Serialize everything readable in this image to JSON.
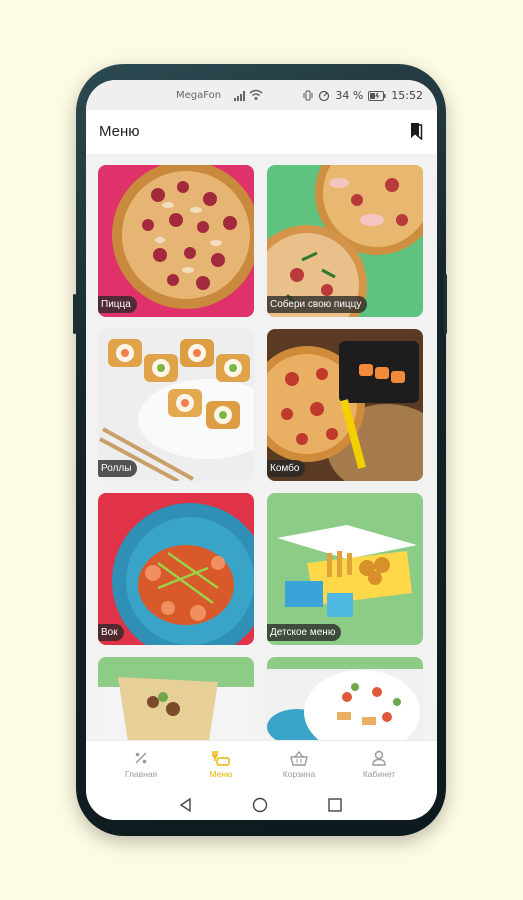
{
  "status_bar": {
    "carrier": "MegaFon",
    "battery": "34 %",
    "time": "15:52"
  },
  "app_bar": {
    "title": "Меню"
  },
  "categories": [
    {
      "label": "Пицца"
    },
    {
      "label": "Собери свою пиццу"
    },
    {
      "label": "Роллы"
    },
    {
      "label": "Комбо"
    },
    {
      "label": "Вок"
    },
    {
      "label": "Детское меню"
    },
    {
      "label": ""
    },
    {
      "label": ""
    }
  ],
  "bottom_nav": [
    {
      "label": "Главная",
      "icon": "percent-icon"
    },
    {
      "label": "Меню",
      "icon": "menu-food-icon",
      "active": true
    },
    {
      "label": "Корзина",
      "icon": "basket-icon"
    },
    {
      "label": "Кабинет",
      "icon": "user-icon"
    }
  ],
  "colors": {
    "accent": "#e9b400",
    "background": "#fdfbe3"
  }
}
